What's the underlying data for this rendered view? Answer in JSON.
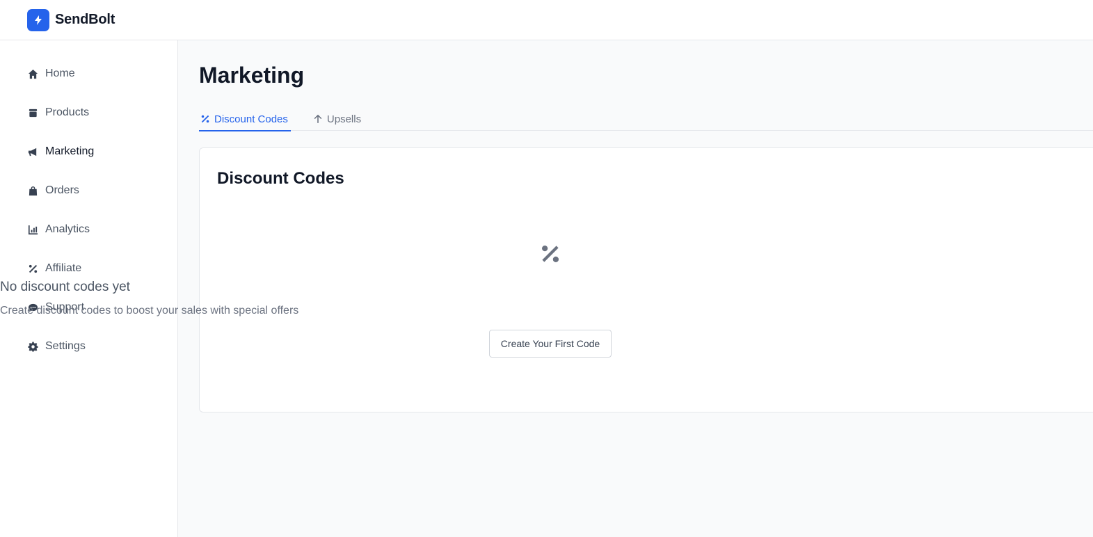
{
  "app": {
    "brand": "SendBolt"
  },
  "sidebar": {
    "items": [
      {
        "label": "Home",
        "icon": "home-icon"
      },
      {
        "label": "Products",
        "icon": "box-icon"
      },
      {
        "label": "Marketing",
        "icon": "megaphone-icon",
        "active": true
      },
      {
        "label": "Orders",
        "icon": "bag-icon"
      },
      {
        "label": "Analytics",
        "icon": "chart-icon"
      },
      {
        "label": "Affiliate",
        "icon": "percent-icon"
      },
      {
        "label": "Support",
        "icon": "chat-icon"
      },
      {
        "label": "Settings",
        "icon": "gear-icon"
      }
    ]
  },
  "main": {
    "title": "Marketing",
    "tabs": [
      {
        "label": "Discount Codes",
        "icon": "percent-icon",
        "active": true
      },
      {
        "label": "Upsells",
        "icon": "arrow-up-icon"
      }
    ],
    "card": {
      "title": "Discount Codes",
      "empty": {
        "title": "No discount codes yet",
        "subtitle": "Create discount codes to boost your sales with special offers",
        "button": "Create Your First Code"
      }
    }
  },
  "colors": {
    "accent": "#2563eb",
    "text": "#111827",
    "muted": "#6b7280"
  }
}
